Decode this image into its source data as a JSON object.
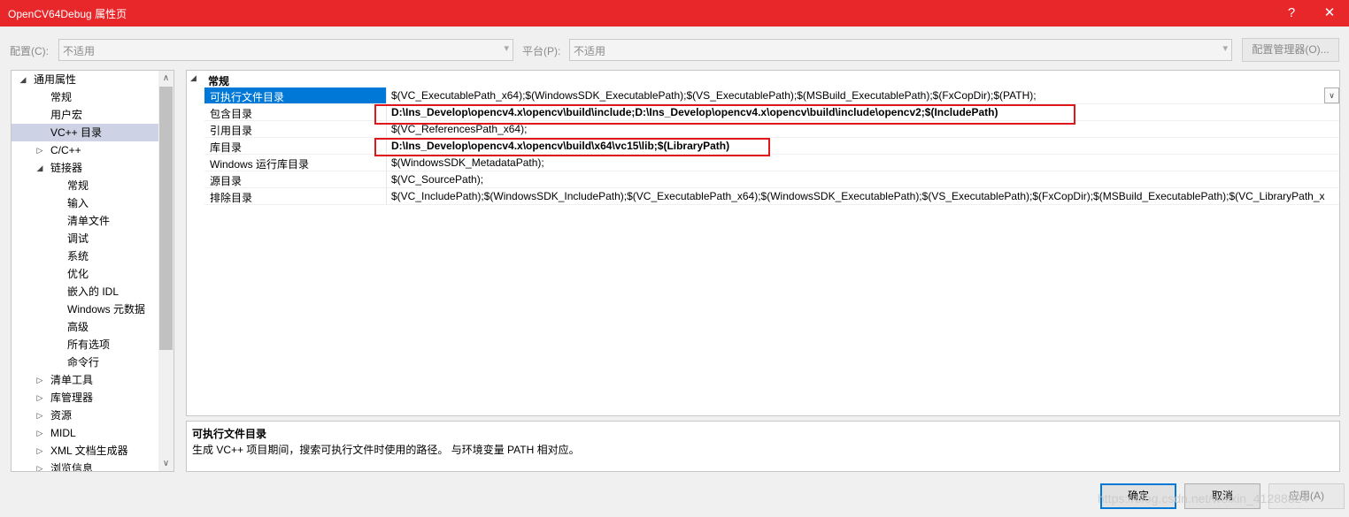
{
  "window": {
    "title": "OpenCV64Debug 属性页",
    "help_glyph": "?",
    "close_glyph": "✕"
  },
  "toolbar": {
    "config_label": "配置(C):",
    "config_value": "不适用",
    "platform_label": "平台(P):",
    "platform_value": "不适用",
    "config_manager_label": "配置管理器(O)..."
  },
  "tree": {
    "items": [
      {
        "label": "通用属性",
        "expander": "◢"
      },
      {
        "label": "常规"
      },
      {
        "label": "用户宏"
      },
      {
        "label": "VC++ 目录"
      },
      {
        "label": "C/C++",
        "expander": "▷"
      },
      {
        "label": "链接器",
        "expander": "◢"
      },
      {
        "label": "常规"
      },
      {
        "label": "输入"
      },
      {
        "label": "清单文件"
      },
      {
        "label": "调试"
      },
      {
        "label": "系统"
      },
      {
        "label": "优化"
      },
      {
        "label": "嵌入的 IDL"
      },
      {
        "label": "Windows 元数据"
      },
      {
        "label": "高级"
      },
      {
        "label": "所有选项"
      },
      {
        "label": "命令行"
      },
      {
        "label": "清单工具",
        "expander": "▷"
      },
      {
        "label": "库管理器",
        "expander": "▷"
      },
      {
        "label": "资源",
        "expander": "▷"
      },
      {
        "label": "MIDL",
        "expander": "▷"
      },
      {
        "label": "XML 文档生成器",
        "expander": "▷"
      },
      {
        "label": "浏览信息",
        "expander": "▷"
      }
    ]
  },
  "grid": {
    "section_label": "常规",
    "section_expander": "◢",
    "rows": [
      {
        "name": "可执行文件目录",
        "value": "$(VC_ExecutablePath_x64);$(WindowsSDK_ExecutablePath);$(VS_ExecutablePath);$(MSBuild_ExecutablePath);$(FxCopDir);$(PATH);"
      },
      {
        "name": "包含目录",
        "value": "D:\\Ins_Develop\\opencv4.x\\opencv\\build\\include;D:\\Ins_Develop\\opencv4.x\\opencv\\build\\include\\opencv2;$(IncludePath)"
      },
      {
        "name": "引用目录",
        "value": "$(VC_ReferencesPath_x64);"
      },
      {
        "name": "库目录",
        "value": "D:\\Ins_Develop\\opencv4.x\\opencv\\build\\x64\\vc15\\lib;$(LibraryPath)"
      },
      {
        "name": "Windows 运行库目录",
        "value": "$(WindowsSDK_MetadataPath);"
      },
      {
        "name": "源目录",
        "value": "$(VC_SourcePath);"
      },
      {
        "name": "排除目录",
        "value": "$(VC_IncludePath);$(WindowsSDK_IncludePath);$(VC_ExecutablePath_x64);$(WindowsSDK_ExecutablePath);$(VS_ExecutablePath);$(FxCopDir);$(MSBuild_ExecutablePath);$(VC_LibraryPath_x"
      }
    ],
    "dropdown_glyph": "∨"
  },
  "description": {
    "title": "可执行文件目录",
    "text": "生成 VC++ 项目期间，搜索可执行文件时使用的路径。 与环境变量 PATH 相对应。"
  },
  "buttons": {
    "ok": "确定",
    "cancel": "取消",
    "apply": "应用(A)"
  },
  "watermark": "https://blog.csdn.net/weixin_41288824",
  "colors": {
    "titlebar": "#e8272b",
    "selection": "#0078d7",
    "tree_selection": "#cdd3e4",
    "highlight_box": "#e0161b"
  }
}
